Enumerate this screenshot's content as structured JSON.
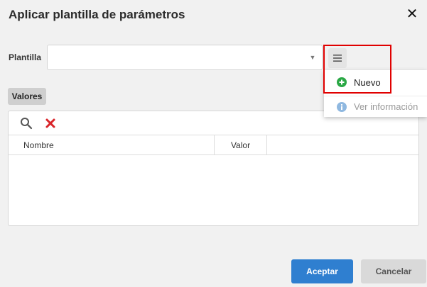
{
  "dialog": {
    "title": "Aplicar plantilla de parámetros"
  },
  "plantilla": {
    "label": "Plantilla",
    "value": ""
  },
  "menu": {
    "items": [
      {
        "label": "Nuevo",
        "icon": "add-circle-icon",
        "color": "#2aa845"
      },
      {
        "label": "Ver información",
        "icon": "info-circle-icon",
        "color": "#8fb8e0"
      }
    ]
  },
  "valores": {
    "tag": "Valores",
    "columns": [
      "Nombre",
      "Valor"
    ],
    "rows": []
  },
  "buttons": {
    "accept": "Aceptar",
    "cancel": "Cancelar"
  },
  "colors": {
    "accent": "#2f7fd0",
    "highlight": "#e00000",
    "delete": "#d9252a"
  }
}
